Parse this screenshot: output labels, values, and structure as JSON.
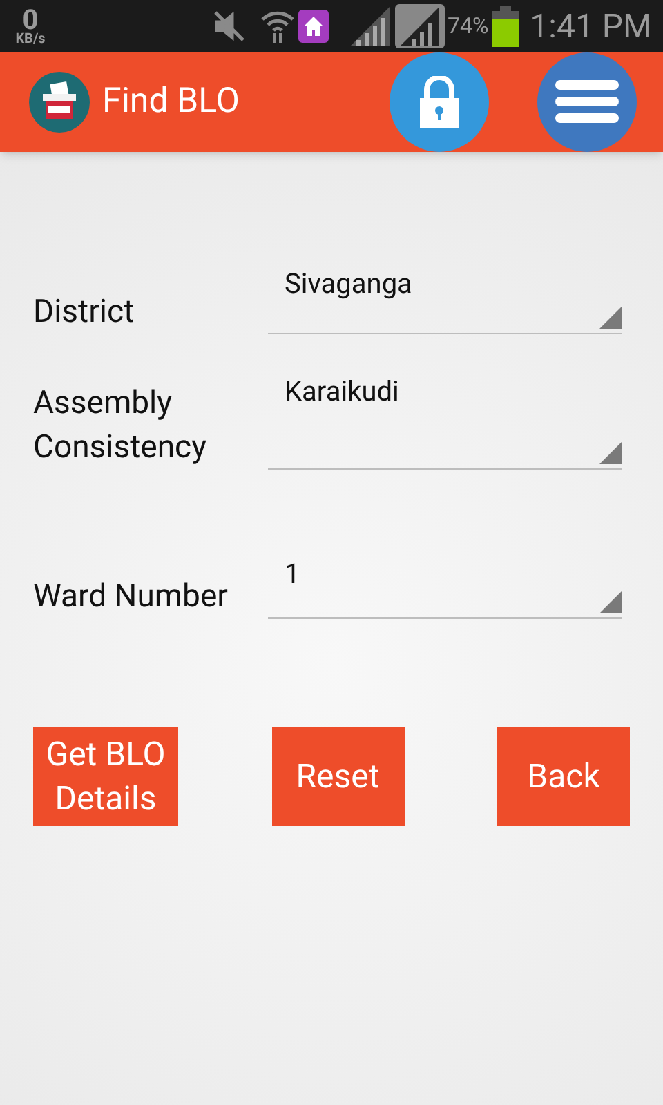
{
  "status_bar": {
    "speed": "0",
    "speed_unit": "KB/s",
    "battery": "74%",
    "time": "1:41 PM"
  },
  "app_bar": {
    "title": "Find BLO"
  },
  "fields": [
    {
      "label": "District",
      "value": "Sivaganga",
      "kind": "single"
    },
    {
      "label": "Assembly Consistency",
      "value": "Karaikudi",
      "kind": "tall"
    },
    {
      "label": "Ward Number",
      "value": "1",
      "kind": "low"
    }
  ],
  "buttons": [
    "Get BLO Details",
    "Reset",
    "Back"
  ]
}
